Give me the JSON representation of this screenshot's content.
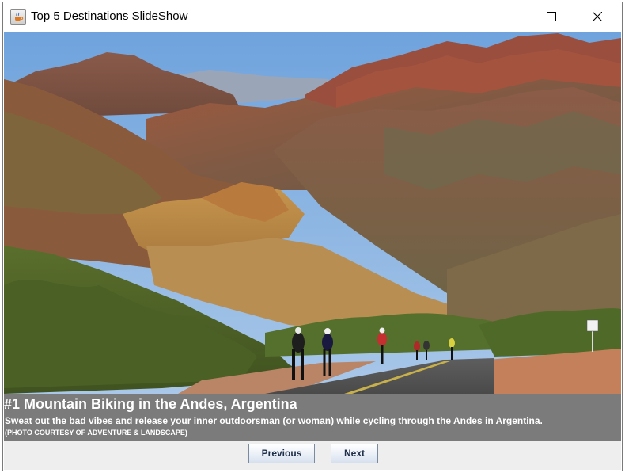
{
  "window": {
    "title": "Top 5 Destinations SlideShow",
    "app_icon": "java-cup-icon",
    "controls": {
      "minimize_icon": "minimize-icon",
      "maximize_icon": "maximize-icon",
      "close_icon": "close-icon"
    }
  },
  "slide": {
    "image_subject": "mountain-biking-andes-photo",
    "title": "#1 Mountain Biking in the Andes, Argentina",
    "description": "Sweat out the bad vibes and release your inner outdoorsman (or woman) while cycling through the Andes in Argentina.",
    "credit": "(PHOTO COURTESY OF ADVENTURE & LANDSCAPE)"
  },
  "buttons": {
    "previous": "Previous",
    "next": "Next"
  },
  "colors": {
    "caption_background": "#7b7b7b",
    "caption_text": "#ffffff",
    "content_background": "#eeeeee",
    "button_text": "#1f2f4a"
  }
}
